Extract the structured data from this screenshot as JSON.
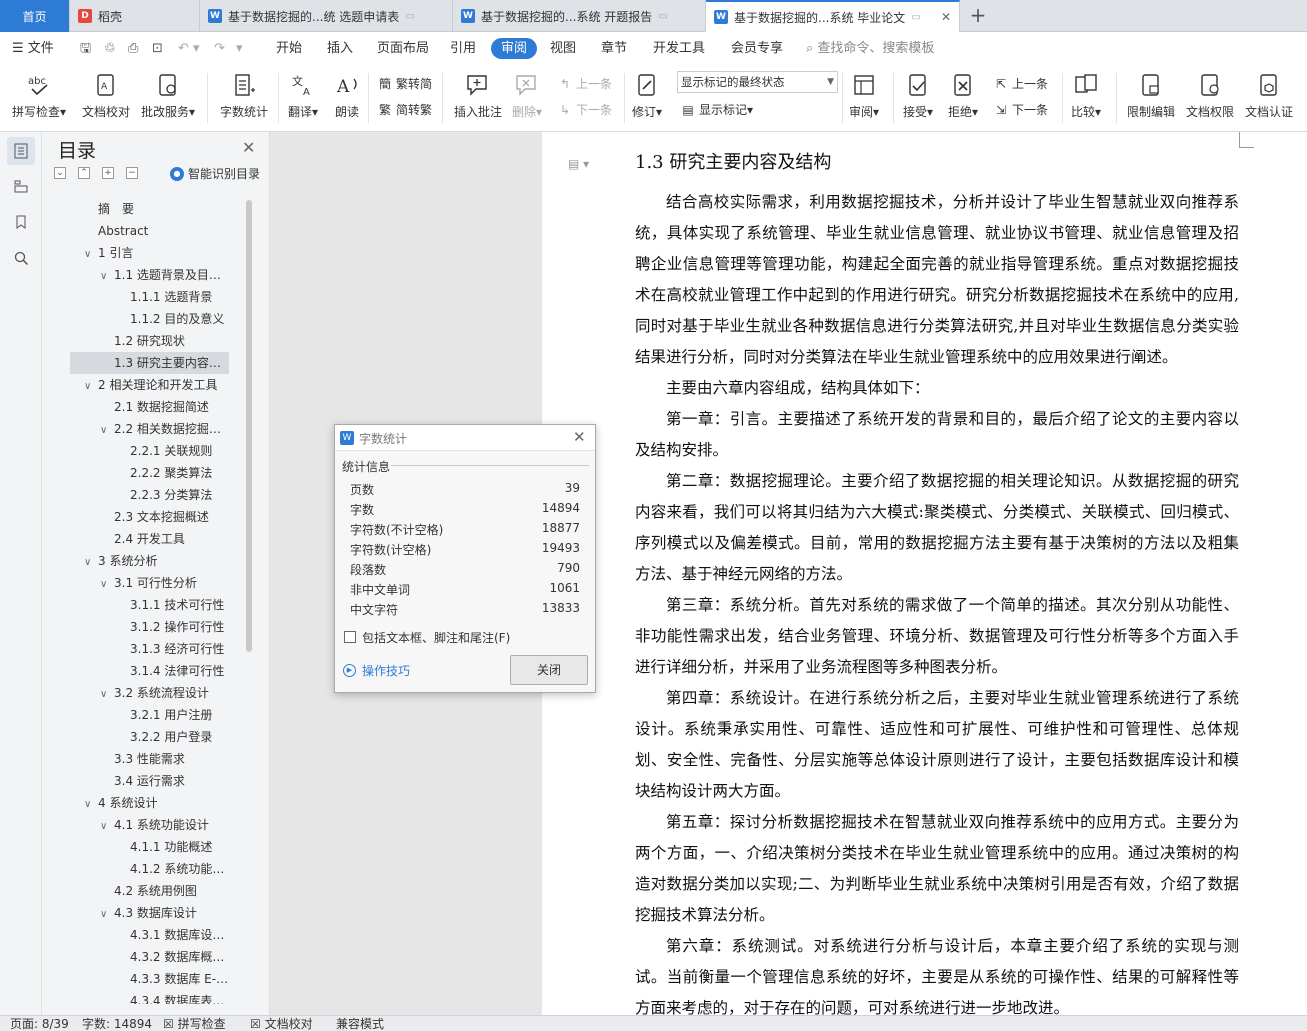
{
  "tabs": [
    {
      "label": "首页",
      "type": "home"
    },
    {
      "label": "稻壳",
      "icon": "daoke-icon"
    },
    {
      "label": "基于数据挖掘的...统 选题申请表",
      "icon": "wps-writer-icon"
    },
    {
      "label": "基于数据挖掘的...系统 开题报告",
      "icon": "wps-writer-icon"
    },
    {
      "label": "基于数据挖掘的...系统 毕业论文",
      "icon": "wps-writer-icon",
      "active": true
    }
  ],
  "menu": {
    "file": "文件",
    "items": [
      "开始",
      "插入",
      "页面布局",
      "引用",
      "审阅",
      "视图",
      "章节",
      "开发工具",
      "会员专享"
    ],
    "active": "审阅",
    "search": "查找命令、搜索模板"
  },
  "toolbar": {
    "spell": "拼写检查",
    "doc_check": "文档校对",
    "batch": "批改服务",
    "word_count": "字数统计",
    "translate": "翻译",
    "read": "朗读",
    "trad": "繁转简",
    "simp": "简转繁",
    "insert_comment": "插入批注",
    "delete": "删除",
    "prev": "上一条",
    "next": "下一条",
    "revise": "修订",
    "markup_state": "显示标记的最终状态",
    "show_markup": "显示标记",
    "review": "审阅",
    "accept": "接受",
    "reject": "拒绝",
    "prev2": "上一条",
    "next2": "下一条",
    "compare": "比较",
    "restrict": "限制编辑",
    "doc_perm": "文档权限",
    "doc_auth": "文档认证"
  },
  "toc": {
    "title": "目录",
    "smart": "智能识别目录",
    "items": [
      {
        "label": "摘　要",
        "level": 0,
        "arrow": false
      },
      {
        "label": "Abstract",
        "level": 0,
        "arrow": false
      },
      {
        "label": "1  引言",
        "level": 0,
        "arrow": true
      },
      {
        "label": "1.1 选题背景及目的意义",
        "level": 1,
        "arrow": true
      },
      {
        "label": "1.1.1 选题背景",
        "level": 2,
        "arrow": false
      },
      {
        "label": "1.1.2 目的及意义",
        "level": 2,
        "arrow": false
      },
      {
        "label": "1.2 研究现状",
        "level": 1,
        "arrow": false
      },
      {
        "label": "1.3 研究主要内容及结构",
        "level": 1,
        "arrow": false,
        "selected": true
      },
      {
        "label": "2  相关理论和开发工具",
        "level": 0,
        "arrow": true
      },
      {
        "label": "2.1  数据挖掘简述",
        "level": 1,
        "arrow": false
      },
      {
        "label": "2.2  相关数据挖掘算法概...",
        "level": 1,
        "arrow": true
      },
      {
        "label": "2.2.1  关联规则",
        "level": 2,
        "arrow": false
      },
      {
        "label": "2.2.2  聚类算法",
        "level": 2,
        "arrow": false
      },
      {
        "label": "2.2.3  分类算法",
        "level": 2,
        "arrow": false
      },
      {
        "label": "2.3  文本挖掘概述",
        "level": 1,
        "arrow": false
      },
      {
        "label": "2.4  开发工具",
        "level": 1,
        "arrow": false
      },
      {
        "label": "3  系统分析",
        "level": 0,
        "arrow": true
      },
      {
        "label": "3.1 可行性分析",
        "level": 1,
        "arrow": true
      },
      {
        "label": "3.1.1  技术可行性",
        "level": 2,
        "arrow": false
      },
      {
        "label": "3.1.2 操作可行性",
        "level": 2,
        "arrow": false
      },
      {
        "label": "3.1.3  经济可行性",
        "level": 2,
        "arrow": false
      },
      {
        "label": "3.1.4  法律可行性",
        "level": 2,
        "arrow": false
      },
      {
        "label": "3.2 系统流程设计",
        "level": 1,
        "arrow": true
      },
      {
        "label": "3.2.1  用户注册",
        "level": 2,
        "arrow": false
      },
      {
        "label": "3.2.2  用户登录",
        "level": 2,
        "arrow": false
      },
      {
        "label": "3.3 性能需求",
        "level": 1,
        "arrow": false
      },
      {
        "label": "3.4 运行需求",
        "level": 1,
        "arrow": false
      },
      {
        "label": "4  系统设计",
        "level": 0,
        "arrow": true
      },
      {
        "label": "4.1 系统功能设计",
        "level": 1,
        "arrow": true
      },
      {
        "label": "4.1.1 功能概述",
        "level": 2,
        "arrow": false
      },
      {
        "label": "4.1.2 系统功能结构",
        "level": 2,
        "arrow": false
      },
      {
        "label": "4.2 系统用例图",
        "level": 1,
        "arrow": false
      },
      {
        "label": "4.3 数据库设计",
        "level": 1,
        "arrow": true
      },
      {
        "label": "4.3.1 数据库设计原则",
        "level": 2,
        "arrow": false
      },
      {
        "label": "4.3.2 数据库概念设计",
        "level": 2,
        "arrow": false
      },
      {
        "label": "4.3.3 数据库 E-R 图设...",
        "level": 2,
        "arrow": false
      },
      {
        "label": "4.3.4 数据库表设计",
        "level": 2,
        "arrow": false
      }
    ]
  },
  "document": {
    "heading": "1.3 研究主要内容及结构",
    "paragraphs": [
      "结合高校实际需求，利用数据挖掘技术，分析并设计了毕业生智慧就业双向推荐系统，具体实现了系统管理、毕业生就业信息管理、就业协议书管理、就业信息管理及招聘企业信息管理等管理功能，构建起全面完善的就业指导管理系统。重点对数据挖掘技术在高校就业管理工作中起到的作用进行研究。研究分析数据挖掘技术在系统中的应用,同时对基于毕业生就业各种数据信息进行分类算法研究,并且对毕业生数据信息分类实验结果进行分析，同时对分类算法在毕业生就业管理系统中的应用效果进行阐述。",
      "主要由六章内容组成，结构具体如下：",
      "第一章：引言。主要描述了系统开发的背景和目的，最后介绍了论文的主要内容以及结构安排。",
      "第二章：数据挖掘理论。主要介绍了数据挖掘的相关理论知识。从数据挖掘的研究内容来看，我们可以将其归结为六大模式:聚类模式、分类模式、关联模式、回归模式、序列模式以及偏差模式。目前，常用的数据挖掘方法主要有基于决策树的方法以及粗集方法、基于神经元网络的方法。",
      "第三章：系统分析。首先对系统的需求做了一个简单的描述。其次分别从功能性、非功能性需求出发，结合业务管理、环境分析、数据管理及可行性分析等多个方面入手进行详细分析，并采用了业务流程图等多种图表分析。",
      "第四章：系统设计。在进行系统分析之后，主要对毕业生就业管理系统进行了系统设计。系统秉承实用性、可靠性、适应性和可扩展性、可维护性和可管理性、总体规划、安全性、完备性、分层实施等总体设计原则进行了设计，主要包括数据库设计和模块结构设计两大方面。",
      "第五章：探讨分析数据挖掘技术在智慧就业双向推荐系统中的应用方式。主要分为两个方面，一、介绍决策树分类技术在毕业生就业管理系统中的应用。通过决策树的构造对数据分类加以实现;二、为判断毕业生就业系统中决策树引用是否有效，介绍了数据挖掘技术算法分析。",
      "第六章：系统测试。对系统进行分析与设计后，本章主要介绍了系统的实现与测试。当前衡量一个管理信息系统的好坏，主要是从系统的可操作性、结果的可解释性等方面来考虑的，对于存在的问题，可对系统进行进一步地改进。"
    ]
  },
  "dialog": {
    "title": "字数统计",
    "section": "统计信息",
    "rows": [
      {
        "k": "页数",
        "v": "39"
      },
      {
        "k": "字数",
        "v": "14894"
      },
      {
        "k": "字符数(不计空格)",
        "v": "18877"
      },
      {
        "k": "字符数(计空格)",
        "v": "19493"
      },
      {
        "k": "段落数",
        "v": "790"
      },
      {
        "k": "非中文单词",
        "v": "1061"
      },
      {
        "k": "中文字符",
        "v": "13833"
      }
    ],
    "include": "包括文本框、脚注和尾注(F)",
    "tips": "操作技巧",
    "close": "关闭"
  },
  "status": {
    "page": "页面: 8/39",
    "words": "字数: 14894",
    "spell": "拼写检查",
    "check": "文档校对",
    "compat": "兼容模式"
  },
  "colors": {
    "accent": "#2e7bd6",
    "daoke": "#e5483c"
  }
}
